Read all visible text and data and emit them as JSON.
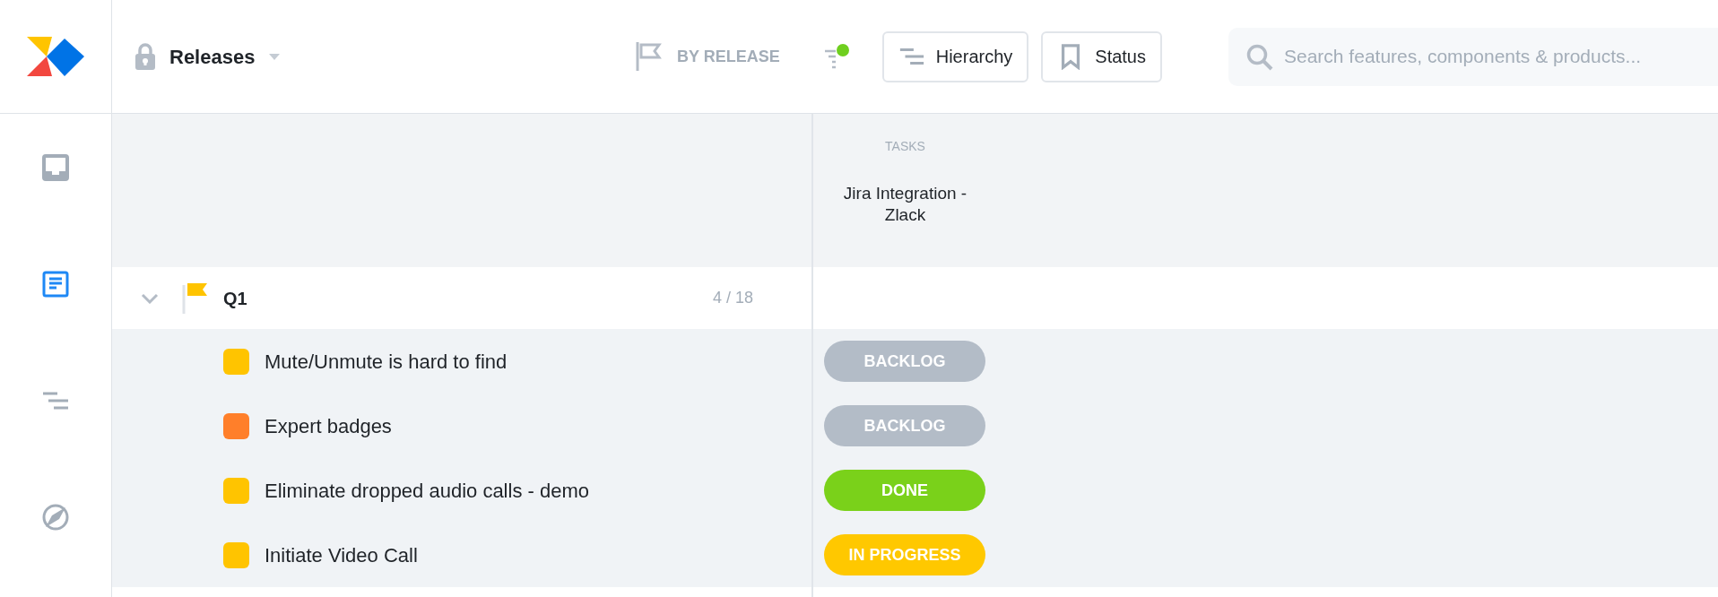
{
  "nav_items": [
    {
      "kind": "inbox",
      "selected": false
    },
    {
      "kind": "notes",
      "selected": true
    },
    {
      "kind": "hierarchy",
      "selected": false
    },
    {
      "kind": "compass",
      "selected": false
    }
  ],
  "header": {
    "title": "Releases",
    "view": "BY RELEASE",
    "filter_active": true,
    "buttons": [
      {
        "kind": "hierarchy",
        "label": "Hierarchy"
      },
      {
        "kind": "status",
        "label": "Status"
      }
    ],
    "search": {
      "placeholder": "Search features, components & products..."
    }
  },
  "columns": [
    {
      "type_label": "TASKS",
      "title": "Jira Integration - Zlack"
    }
  ],
  "groups": [
    {
      "name": "Q1",
      "count": "4 / 18",
      "expanded": true,
      "rows": [
        {
          "name": "Mute/Unmute is hard to find",
          "color": "#ffc400",
          "status": {
            "label": "BACKLOG",
            "color": "#b3bcc7"
          }
        },
        {
          "name": "Expert badges",
          "color": "#ff7f2a",
          "status": {
            "label": "BACKLOG",
            "color": "#b3bcc7"
          }
        },
        {
          "name": "Eliminate dropped audio calls - demo",
          "color": "#ffc400",
          "status": {
            "label": "DONE",
            "color": "#7ad11a"
          }
        },
        {
          "name": "Initiate Video Call",
          "color": "#ffc400",
          "status": {
            "label": "IN PROGRESS",
            "color": "#ffc800"
          }
        }
      ]
    }
  ]
}
